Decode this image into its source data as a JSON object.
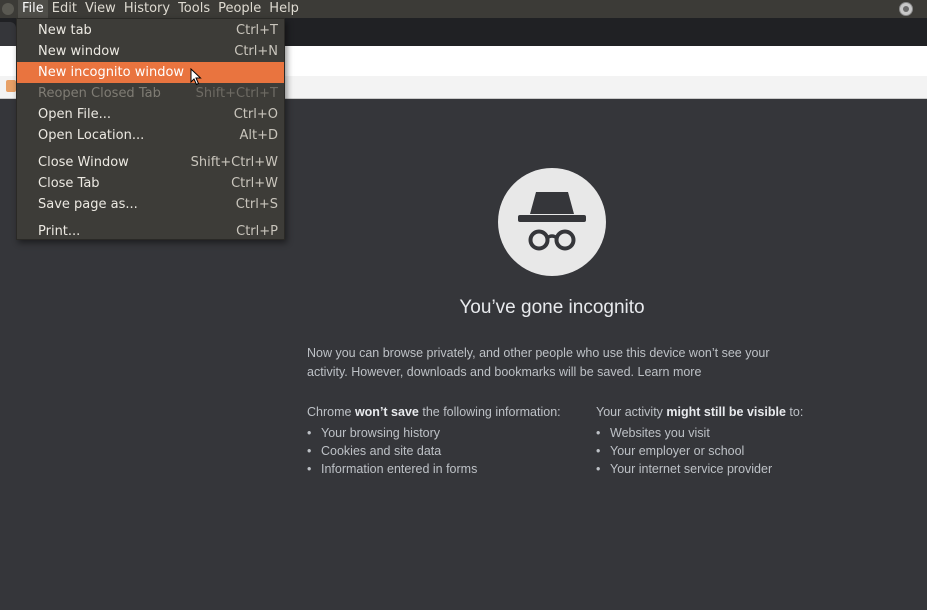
{
  "menubar": {
    "items": [
      "File",
      "Edit",
      "View",
      "History",
      "Tools",
      "People",
      "Help"
    ]
  },
  "file_menu": {
    "items": [
      {
        "label": "New tab",
        "shortcut": "Ctrl+T"
      },
      {
        "label": "New window",
        "shortcut": "Ctrl+N"
      },
      {
        "label": "New incognito window",
        "shortcut": ""
      },
      {
        "label": "Reopen Closed Tab",
        "shortcut": "Shift+Ctrl+T"
      },
      {
        "label": "Open File...",
        "shortcut": "Ctrl+O"
      },
      {
        "label": "Open Location...",
        "shortcut": "Alt+D"
      },
      {
        "label": "Close Window",
        "shortcut": "Shift+Ctrl+W"
      },
      {
        "label": "Close Tab",
        "shortcut": "Ctrl+W"
      },
      {
        "label": "Save page as...",
        "shortcut": "Ctrl+S"
      },
      {
        "label": "Print...",
        "shortcut": "Ctrl+P"
      }
    ],
    "highlighted": "New incognito window",
    "disabled": "Reopen Closed Tab"
  },
  "incognito": {
    "icon": "incognito-icon",
    "heading": "You’ve gone incognito",
    "description": "Now you can browse privately, and other people who use this device won’t see your activity. However, downloads and bookmarks will be saved.",
    "learn_more": "Learn more",
    "wont_save": {
      "prefix": "Chrome",
      "emphasis": "won’t save",
      "suffix": "the following information:",
      "items": [
        "Your browsing history",
        "Cookies and site data",
        "Information entered in forms"
      ]
    },
    "might_visible": {
      "prefix": "Your activity",
      "emphasis": "might still be visible",
      "suffix": "to:",
      "items": [
        "Websites you visit",
        "Your employer or school",
        "Your internet service provider"
      ]
    }
  },
  "colors": {
    "background": "#35363a",
    "menu_highlight": "#e9743f",
    "menubar": "#3c3b37"
  }
}
